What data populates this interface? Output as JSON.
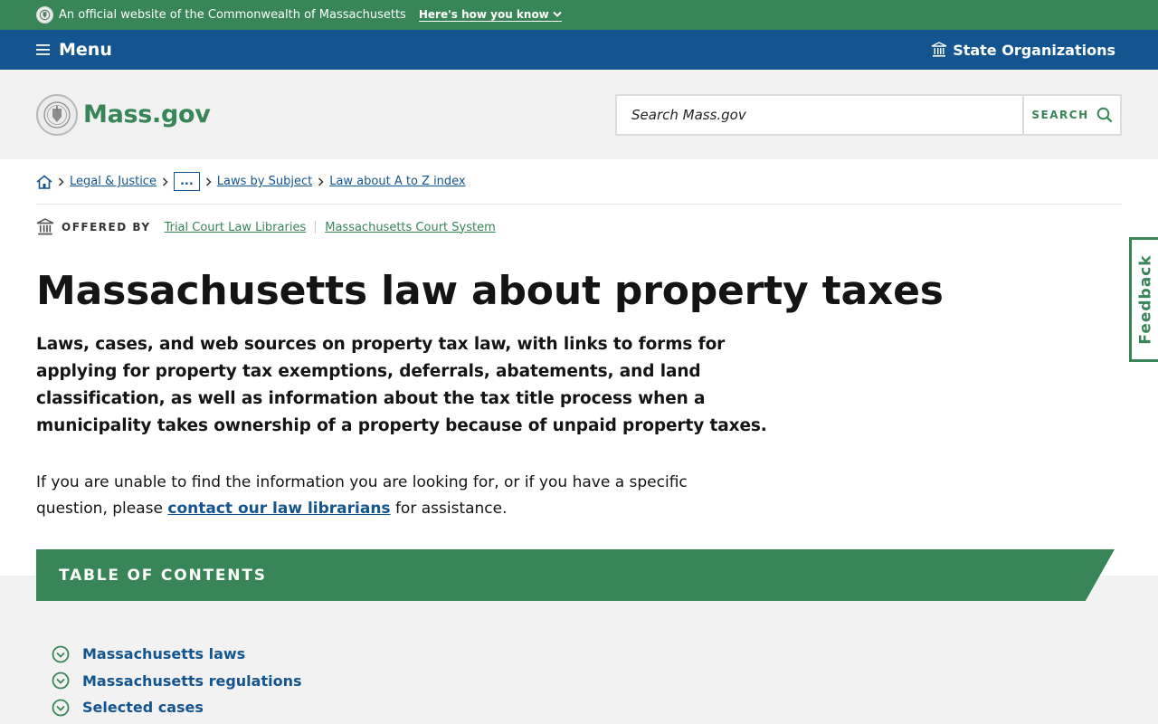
{
  "official_bar": {
    "text": "An official website of the Commonwealth of Massachusetts",
    "howto": "Here's how you know"
  },
  "menu_bar": {
    "menu_label": "Menu",
    "state_orgs_label": "State Organizations"
  },
  "header": {
    "logo_text": "Mass.gov",
    "search_placeholder": "Search Mass.gov",
    "search_button": "SEARCH"
  },
  "breadcrumb": {
    "items": [
      "Legal & Justice",
      "...",
      "Laws by Subject",
      "Law about A to Z index"
    ]
  },
  "offered_by": {
    "label": "OFFERED BY",
    "orgs": [
      "Trial Court Law Libraries",
      "Massachusetts Court System"
    ]
  },
  "page": {
    "title": "Massachusetts law about property taxes",
    "lede": "Laws, cases, and web sources on property tax law, with links to forms for applying for property tax exemptions, deferrals, abatements, and land classification, as well as information about the tax title process when a municipality takes ownership of a property because of unpaid property taxes.",
    "help_before": "If you are unable to find the information you are looking for, or if you have a specific question, please ",
    "help_link": "contact our law librarians",
    "help_after": " for assistance."
  },
  "toc": {
    "title": "TABLE OF CONTENTS",
    "items": [
      "Massachusetts laws",
      "Massachusetts regulations",
      "Selected cases"
    ]
  },
  "feedback": {
    "label": "Feedback"
  },
  "colors": {
    "green": "#388557",
    "blue": "#14558f",
    "gray_bg": "#f2f2f2"
  }
}
